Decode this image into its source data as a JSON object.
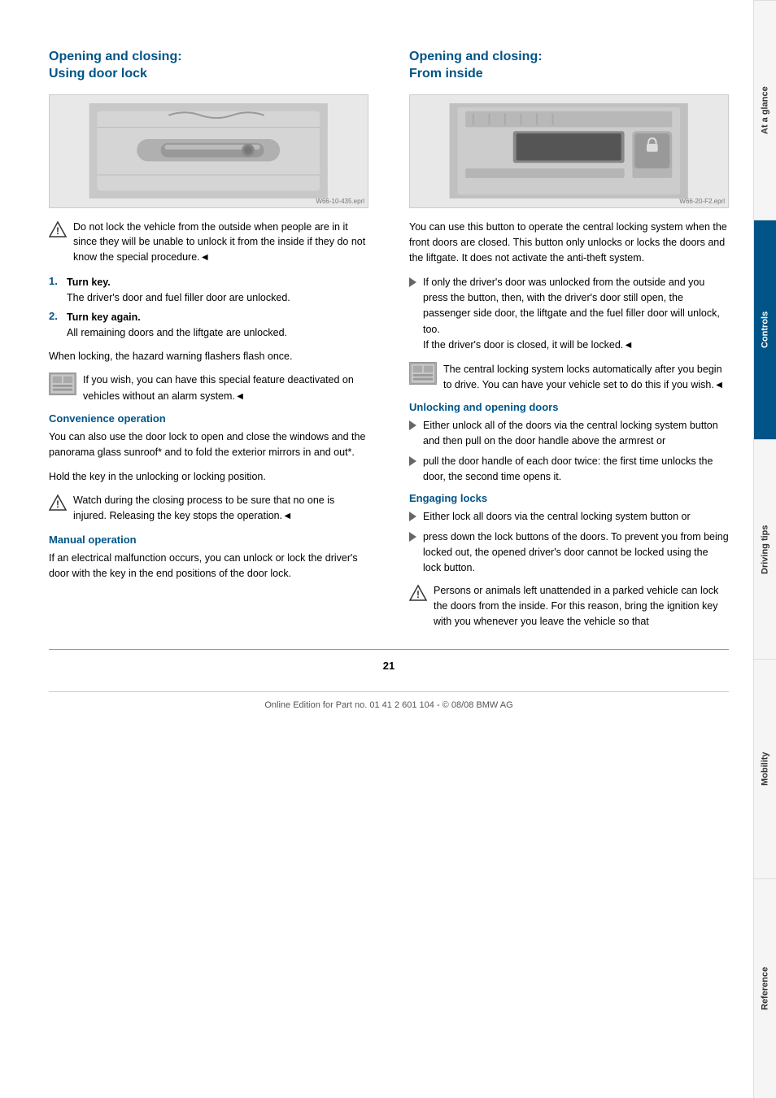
{
  "page": {
    "number": "21",
    "footer": "Online Edition for Part no. 01 41 2 601 104 - © 08/08 BMW AG"
  },
  "sidebar": {
    "tabs": [
      {
        "id": "at-a-glance",
        "label": "At a glance",
        "active": false
      },
      {
        "id": "controls",
        "label": "Controls",
        "active": true
      },
      {
        "id": "driving-tips",
        "label": "Driving tips",
        "active": false
      },
      {
        "id": "mobility",
        "label": "Mobility",
        "active": false
      },
      {
        "id": "reference",
        "label": "Reference",
        "active": false
      }
    ]
  },
  "left_section": {
    "title": "Opening and closing:\nUsing door lock",
    "image_alt": "Door handle exterior view",
    "image_watermark": "W66-10-435.eprl",
    "warning1": {
      "text": "Do not lock the vehicle from the outside when people are in it since they will be unable to unlock it from the inside if they do not know the special procedure.◄"
    },
    "steps": [
      {
        "num": "1.",
        "title": "Turn key.",
        "detail": "The driver's door and fuel filler door are unlocked."
      },
      {
        "num": "2.",
        "title": "Turn key again.",
        "detail": "All remaining doors and the liftgate are unlocked."
      }
    ],
    "body1": "When locking, the hazard warning flashers flash once.",
    "feature_icon_text": "If you wish, you can have this special feature deactivated on vehicles without an alarm system.◄",
    "convenience_title": "Convenience operation",
    "convenience_text": "You can also use the door lock to open and close the windows and the panorama glass sunroof* and to fold the exterior mirrors in and out*.",
    "hold_text": "Hold the key in the unlocking or locking position.",
    "warning2": {
      "text": "Watch during the closing process to be sure that no one is injured. Releasing the key stops the operation.◄"
    },
    "manual_title": "Manual operation",
    "manual_text": "If an electrical malfunction occurs, you can unlock or lock the driver's door with the key in the end positions of the door lock."
  },
  "right_section": {
    "title": "Opening and closing:\nFrom inside",
    "image_alt": "Interior central locking button",
    "image_watermark": "W66-20-F2.eprl",
    "intro_text": "You can use this button to operate the central locking system when the front doors are closed. This button only unlocks or locks the doors and the liftgate. It does not activate the anti-theft system.",
    "note1": {
      "text": "If only the driver's door was unlocked from the outside and you press the button, then, with the driver's door still open, the passenger side door, the liftgate and the fuel filler door will unlock, too.\nIf the driver's door is closed, it will be locked.◄"
    },
    "note2": {
      "text": "The central locking system locks automatically after you begin to drive. You can have your vehicle set to do this if you wish.◄"
    },
    "unlocking_title": "Unlocking and opening doors",
    "unlocking_bullets": [
      "Either unlock all of the doors via the central locking system button and then pull on the door handle above the armrest or",
      "pull the door handle of each door twice: the first time unlocks the door, the second time opens it."
    ],
    "engaging_title": "Engaging locks",
    "engaging_bullets": [
      "Either lock all doors via the central locking system button or",
      "press down the lock buttons of the doors. To prevent you from being locked out, the opened driver's door cannot be locked using the lock button."
    ],
    "warning3": {
      "text": "Persons or animals left unattended in a parked vehicle can lock the doors from the inside. For this reason, bring the ignition key with you whenever you leave the vehicle so that"
    }
  }
}
